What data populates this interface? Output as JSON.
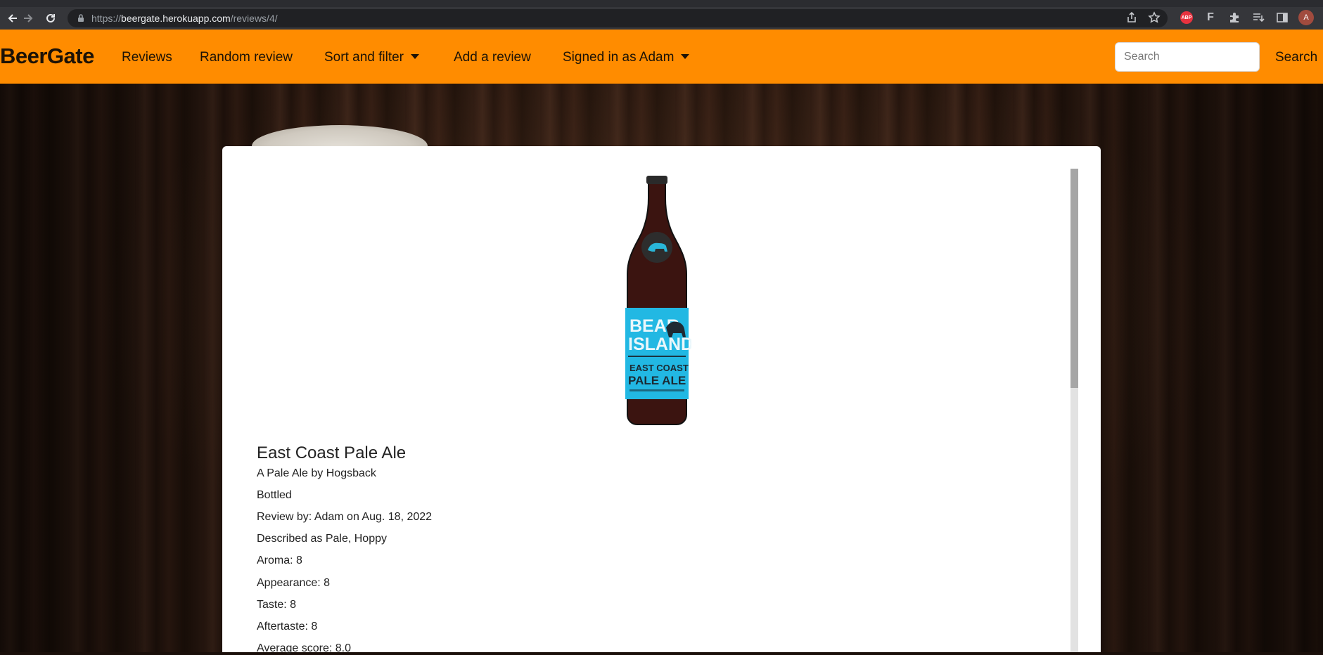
{
  "browser": {
    "url_prefix": "https://",
    "url_host": "beergate.herokuapp.com",
    "url_path": "/reviews/4/",
    "ext_abp": "ABP",
    "ext_f": "F",
    "profile_initial": "A"
  },
  "navbar": {
    "brand": "BeerGate",
    "items": [
      {
        "label": "Reviews"
      },
      {
        "label": "Random review"
      },
      {
        "label": "Sort and filter"
      },
      {
        "label": "Add a review"
      },
      {
        "label": "Signed in as Adam"
      }
    ],
    "search_placeholder": "Search",
    "search_button": "Search"
  },
  "bottle": {
    "label_line1": "BEAR",
    "label_line2": "ISLAND",
    "label_line3": "EAST COAST",
    "label_line4": "PALE ALE"
  },
  "review": {
    "title": "East Coast Pale Ale",
    "subtitle": "A Pale Ale by Hogsback",
    "format": "Bottled",
    "reviewer": "Review by: Adam on Aug. 18, 2022",
    "described": "Described as Pale, Hoppy",
    "aroma": "Aroma: 8",
    "appearance": "Appearance: 8",
    "taste": "Taste: 8",
    "aftertaste": "Aftertaste: 8",
    "average": "Average score: 8.0"
  }
}
